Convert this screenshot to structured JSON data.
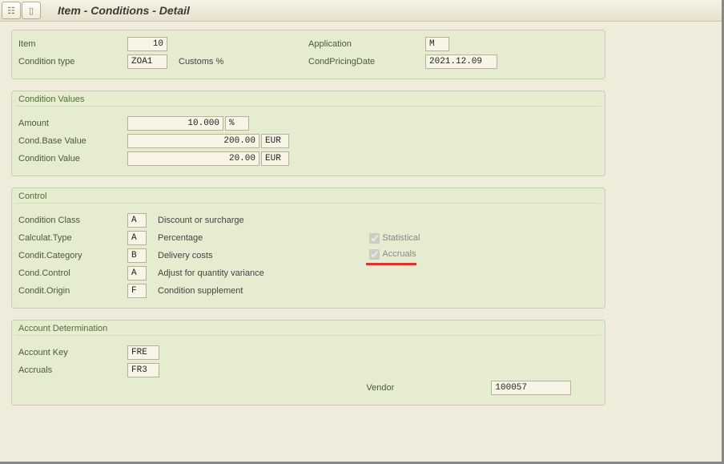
{
  "title": "Item - Conditions - Detail",
  "header": {
    "item_label": "Item",
    "item_value": "10",
    "condtype_label": "Condition type",
    "condtype_value": "ZOA1",
    "condtype_desc": "Customs %",
    "application_label": "Application",
    "application_value": "M",
    "pricingdate_label": "CondPricingDate",
    "pricingdate_value": "2021.12.09"
  },
  "condition_values": {
    "title": "Condition Values",
    "amount_label": "Amount",
    "amount_value": "10.000",
    "amount_unit": "%",
    "base_label": "Cond.Base Value",
    "base_value": "200.00",
    "base_curr": "EUR",
    "value_label": "Condition Value",
    "value_value": "20.00",
    "value_curr": "EUR"
  },
  "control": {
    "title": "Control",
    "cond_class_label": "Condition Class",
    "cond_class_code": "A",
    "cond_class_desc": "Discount or surcharge",
    "calc_type_label": "Calculat.Type",
    "calc_type_code": "A",
    "calc_type_desc": "Percentage",
    "stat_label": "Statistical",
    "stat_checked": true,
    "cat_label": "Condit.Category",
    "cat_code": "B",
    "cat_desc": "Delivery costs",
    "accr_label": "Accruals",
    "accr_checked": true,
    "ctrl_label": "Cond.Control",
    "ctrl_code": "A",
    "ctrl_desc": "Adjust for quantity variance",
    "origin_label": "Condit.Origin",
    "origin_code": "F",
    "origin_desc": "Condition supplement"
  },
  "account_det": {
    "title": "Account Determination",
    "key_label": "Account Key",
    "key_value": "FRE",
    "accruals_label": "Accruals",
    "accruals_value": "FR3",
    "vendor_label": "Vendor",
    "vendor_value": "100057"
  }
}
